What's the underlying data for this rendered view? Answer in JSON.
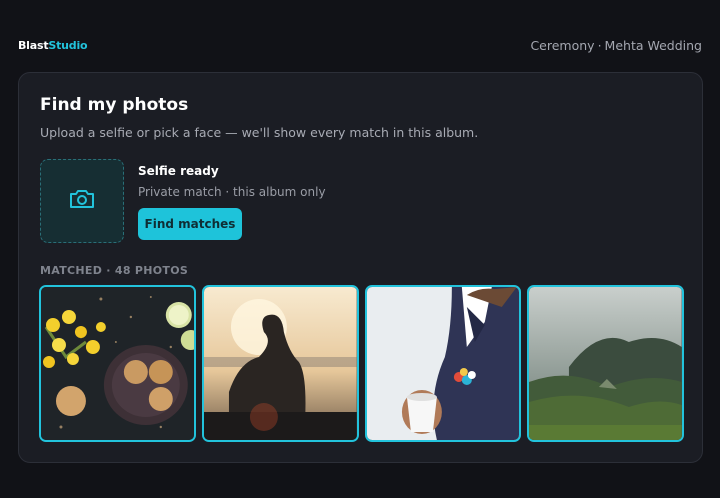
{
  "brand": {
    "part1": "Blast",
    "part2": "Studio"
  },
  "breadcrumb": {
    "event": "Ceremony",
    "separator": "·",
    "album": "Mehta Wedding"
  },
  "finder": {
    "title": "Find my photos",
    "subtitle": "Upload a selfie or pick a face — we'll show every match in this album.",
    "upload_icon": "camera-icon",
    "selfie_status": "Selfie ready",
    "privacy_note": "Private match · this album only",
    "find_button": "Find matches"
  },
  "matches": {
    "label": "MATCHED · 48 PHOTOS",
    "photos": [
      {
        "subject": "cookies-and-daffodils"
      },
      {
        "subject": "silhouette-at-sunset"
      },
      {
        "subject": "man-holding-coffee-cup"
      },
      {
        "subject": "misty-forest-hills"
      }
    ]
  },
  "colors": {
    "accent": "#22c3dc",
    "background": "#111217",
    "card": "#1b1d24"
  }
}
